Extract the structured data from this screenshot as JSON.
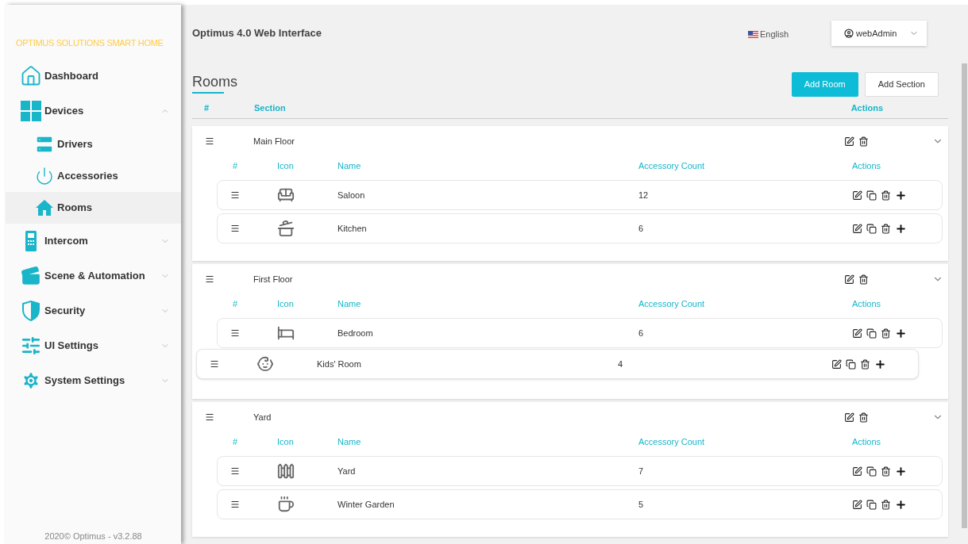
{
  "sidebar": {
    "brand": "OPTIMUS SOLUTIONS SMART HOME",
    "items": [
      {
        "kind": "link",
        "label": "Dashboard"
      },
      {
        "kind": "group",
        "label": "Devices",
        "expanded": true,
        "children": [
          {
            "label": "Drivers",
            "selected": false
          },
          {
            "label": "Accessories",
            "selected": false
          },
          {
            "label": "Rooms",
            "selected": true
          }
        ]
      },
      {
        "kind": "group",
        "label": "Intercom",
        "expanded": false
      },
      {
        "kind": "group",
        "label": "Scene & Automation",
        "expanded": false
      },
      {
        "kind": "group",
        "label": "Security",
        "expanded": false
      },
      {
        "kind": "group",
        "label": "UI Settings",
        "expanded": false
      },
      {
        "kind": "group",
        "label": "System Settings",
        "expanded": false
      }
    ],
    "footer": "2020© Optimus - v3.2.88"
  },
  "header": {
    "title": "Optimus 4.0 Web Interface",
    "language": "English",
    "user": "webAdmin"
  },
  "page": {
    "title": "Rooms",
    "buttons": [
      {
        "label": "Add Room",
        "kind": "primary"
      },
      {
        "label": "Add Section",
        "kind": "secondary"
      }
    ],
    "columns": [
      "#",
      "Section",
      "Actions"
    ]
  },
  "sections": [
    {
      "name": "Main Floor",
      "expanded": true,
      "columns": [
        "#",
        "Icon",
        "Name",
        "Accessory Count",
        "Actions"
      ],
      "rooms": [
        {
          "name": "Saloon",
          "count": "12",
          "dragging": false
        },
        {
          "name": "Kitchen",
          "count": "6",
          "dragging": false
        }
      ]
    },
    {
      "name": "First Floor",
      "expanded": true,
      "columns": [
        "#",
        "Icon",
        "Name",
        "Accessory Count",
        "Actions"
      ],
      "rooms": [
        {
          "name": "Bedroom",
          "count": "6",
          "dragging": false
        },
        {
          "name": "Kids' Room",
          "count": "4",
          "dragging": true
        }
      ]
    },
    {
      "name": "Yard",
      "expanded": true,
      "columns": [
        "#",
        "Icon",
        "Name",
        "Accessory Count",
        "Actions"
      ],
      "rooms": [
        {
          "name": "Yard",
          "count": "7",
          "dragging": false
        },
        {
          "name": "Winter Garden",
          "count": "5",
          "dragging": false
        }
      ]
    }
  ]
}
